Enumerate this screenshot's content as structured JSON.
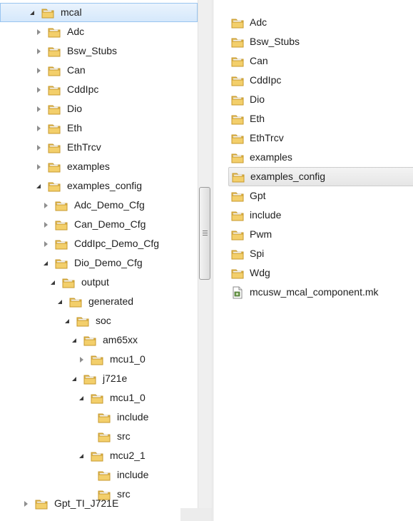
{
  "tree": [
    {
      "label": "mcal",
      "depth": 0,
      "state": "expanded",
      "selected": true
    },
    {
      "label": "Adc",
      "depth": 1,
      "state": "collapsed"
    },
    {
      "label": "Bsw_Stubs",
      "depth": 1,
      "state": "collapsed"
    },
    {
      "label": "Can",
      "depth": 1,
      "state": "collapsed"
    },
    {
      "label": "CddIpc",
      "depth": 1,
      "state": "collapsed"
    },
    {
      "label": "Dio",
      "depth": 1,
      "state": "collapsed"
    },
    {
      "label": "Eth",
      "depth": 1,
      "state": "collapsed"
    },
    {
      "label": "EthTrcv",
      "depth": 1,
      "state": "collapsed"
    },
    {
      "label": "examples",
      "depth": 1,
      "state": "collapsed"
    },
    {
      "label": "examples_config",
      "depth": 1,
      "state": "expanded"
    },
    {
      "label": "Adc_Demo_Cfg",
      "depth": 2,
      "state": "collapsed"
    },
    {
      "label": "Can_Demo_Cfg",
      "depth": 2,
      "state": "collapsed"
    },
    {
      "label": "CddIpc_Demo_Cfg",
      "depth": 2,
      "state": "collapsed"
    },
    {
      "label": "Dio_Demo_Cfg",
      "depth": 2,
      "state": "expanded"
    },
    {
      "label": "output",
      "depth": 3,
      "state": "expanded"
    },
    {
      "label": "generated",
      "depth": 4,
      "state": "expanded"
    },
    {
      "label": "soc",
      "depth": 5,
      "state": "expanded"
    },
    {
      "label": "am65xx",
      "depth": 6,
      "state": "expanded"
    },
    {
      "label": "mcu1_0",
      "depth": 7,
      "state": "collapsed"
    },
    {
      "label": "j721e",
      "depth": 6,
      "state": "expanded"
    },
    {
      "label": "mcu1_0",
      "depth": 7,
      "state": "expanded"
    },
    {
      "label": "include",
      "depth": 8,
      "state": "none"
    },
    {
      "label": "src",
      "depth": 8,
      "state": "none"
    },
    {
      "label": "mcu2_1",
      "depth": 7,
      "state": "expanded"
    },
    {
      "label": "include",
      "depth": 8,
      "state": "none"
    },
    {
      "label": "src",
      "depth": 8,
      "state": "none"
    },
    {
      "label": "Gpt_TI_J721E",
      "depth": 0,
      "state": "collapsed",
      "partial": true
    }
  ],
  "content": [
    {
      "label": "Adc",
      "type": "folder"
    },
    {
      "label": "Bsw_Stubs",
      "type": "folder"
    },
    {
      "label": "Can",
      "type": "folder"
    },
    {
      "label": "CddIpc",
      "type": "folder"
    },
    {
      "label": "Dio",
      "type": "folder"
    },
    {
      "label": "Eth",
      "type": "folder"
    },
    {
      "label": "EthTrcv",
      "type": "folder"
    },
    {
      "label": "examples",
      "type": "folder"
    },
    {
      "label": "examples_config",
      "type": "folder",
      "selected": true
    },
    {
      "label": "Gpt",
      "type": "folder"
    },
    {
      "label": "include",
      "type": "folder"
    },
    {
      "label": "Pwm",
      "type": "folder"
    },
    {
      "label": "Spi",
      "type": "folder"
    },
    {
      "label": "Wdg",
      "type": "folder"
    },
    {
      "label": "mcusw_mcal_component.mk",
      "type": "file"
    }
  ],
  "icons": {
    "folder": "folder-icon",
    "file": "makefile-icon",
    "expanded": "expanded-arrow-icon",
    "collapsed": "collapsed-arrow-icon"
  },
  "colors": {
    "folder_body": "#f3cf6b",
    "folder_edge": "#c79a2c",
    "selection": "#d5e8fb",
    "selection_border": "#9ac5f0"
  }
}
